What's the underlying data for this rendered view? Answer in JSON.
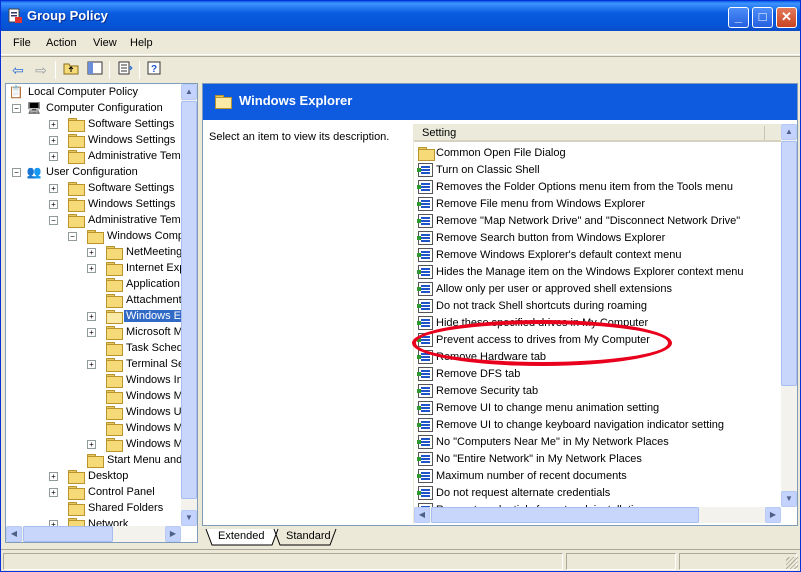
{
  "window": {
    "title": "Group Policy"
  },
  "menu": [
    "File",
    "Action",
    "View",
    "Help"
  ],
  "toolbar": [
    "back-icon",
    "forward-icon",
    "up-folder-icon",
    "show-hide-tree-icon",
    "export-list-icon",
    "help-icon"
  ],
  "tree": [
    {
      "label": "Local Computer Policy",
      "icon": "policy-icon"
    },
    {
      "label": "Computer Configuration",
      "icon": "computer-icon"
    },
    {
      "label": "Software Settings",
      "icon": "folder-icon"
    },
    {
      "label": "Windows Settings",
      "icon": "folder-icon"
    },
    {
      "label": "Administrative Template",
      "icon": "folder-icon"
    },
    {
      "label": "User Configuration",
      "icon": "user-icon"
    },
    {
      "label": "Software Settings",
      "icon": "folder-icon"
    },
    {
      "label": "Windows Settings",
      "icon": "folder-icon"
    },
    {
      "label": "Administrative Template",
      "icon": "folder-icon"
    },
    {
      "label": "Windows Componer",
      "icon": "folder-icon"
    },
    {
      "label": "NetMeeting",
      "icon": "folder-icon"
    },
    {
      "label": "Internet Explore",
      "icon": "folder-icon"
    },
    {
      "label": "Application Com",
      "icon": "folder-icon"
    },
    {
      "label": "Attachment Mar",
      "icon": "folder-icon"
    },
    {
      "label": "Windows Explor",
      "icon": "folder-open-icon"
    },
    {
      "label": "Microsoft Manag",
      "icon": "folder-icon"
    },
    {
      "label": "Task Scheduler",
      "icon": "folder-icon"
    },
    {
      "label": "Terminal Service",
      "icon": "folder-icon"
    },
    {
      "label": "Windows Installe",
      "icon": "folder-icon"
    },
    {
      "label": "Windows Messe",
      "icon": "folder-icon"
    },
    {
      "label": "Windows Updat",
      "icon": "folder-icon"
    },
    {
      "label": "Windows Movie",
      "icon": "folder-icon"
    },
    {
      "label": "Windows Media",
      "icon": "folder-icon"
    },
    {
      "label": "Start Menu and Tasl",
      "icon": "folder-icon"
    },
    {
      "label": "Desktop",
      "icon": "folder-icon"
    },
    {
      "label": "Control Panel",
      "icon": "folder-icon"
    },
    {
      "label": "Shared Folders",
      "icon": "folder-icon"
    },
    {
      "label": "Network",
      "icon": "folder-icon"
    }
  ],
  "right": {
    "header_title": "Windows Explorer",
    "description": "Select an item to view its description.",
    "column_header": "Setting",
    "settings": [
      "Common Open File Dialog",
      "Turn on Classic Shell",
      "Removes the Folder Options menu item from the Tools menu",
      "Remove File menu from Windows Explorer",
      "Remove \"Map Network Drive\" and \"Disconnect Network Drive\"",
      "Remove Search button from Windows Explorer",
      "Remove Windows Explorer's default context menu",
      "Hides the Manage item on the Windows Explorer context menu",
      "Allow only per user or approved shell extensions",
      "Do not track Shell shortcuts during roaming",
      "Hide these specified drives in My Computer",
      "Prevent access to drives from My Computer",
      "Remove Hardware tab",
      "Remove DFS tab",
      "Remove Security tab",
      "Remove UI to change menu animation setting",
      "Remove UI to change keyboard navigation indicator setting",
      "No \"Computers Near Me\" in My Network Places",
      "No \"Entire Network\" in My Network Places",
      "Maximum number of recent documents",
      "Do not request alternate credentials",
      "Request credentials for network installations"
    ]
  },
  "tabs": [
    "Extended",
    "Standard"
  ],
  "annotation": {
    "color": "#E8001C",
    "target": "Prevent access to drives from My Computer"
  }
}
